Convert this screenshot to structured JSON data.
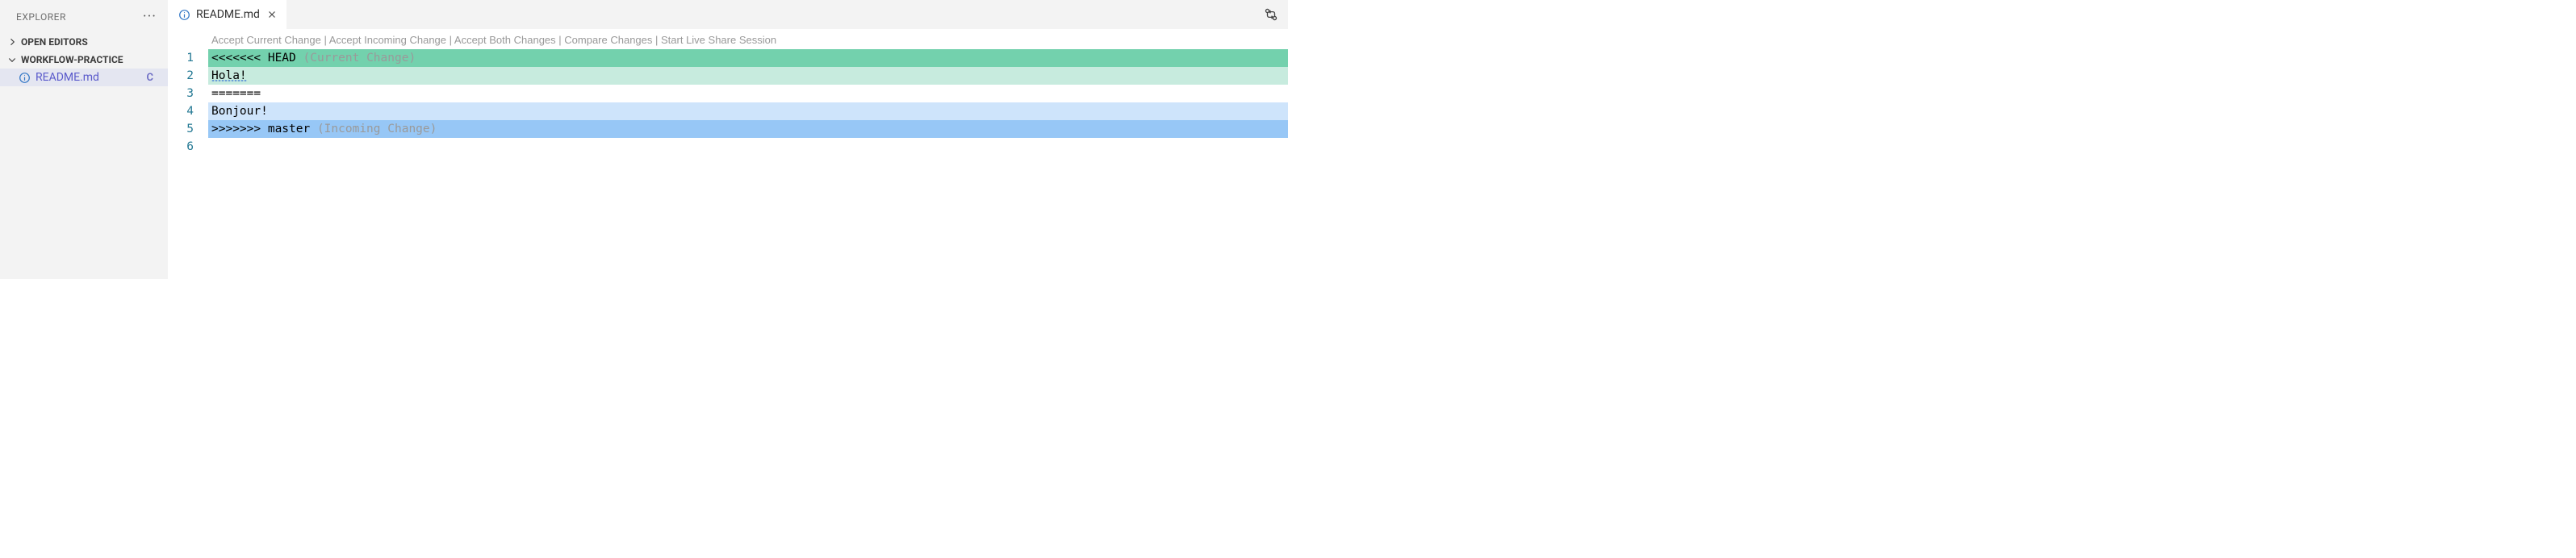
{
  "sidebar": {
    "title": "EXPLORER",
    "sections": [
      {
        "label": "OPEN EDITORS",
        "expanded": false
      },
      {
        "label": "WORKFLOW-PRACTICE",
        "expanded": true
      }
    ],
    "file": {
      "name": "README.md",
      "status": "C"
    }
  },
  "tab": {
    "name": "README.md"
  },
  "codelens": {
    "actions": [
      "Accept Current Change",
      "Accept Incoming Change",
      "Accept Both Changes",
      "Compare Changes",
      "Start Live Share Session"
    ],
    "sep": " | "
  },
  "code": {
    "lines": [
      {
        "num": "1",
        "class": "line-current-head",
        "text": "<<<<<<< HEAD ",
        "hint": "(Current Change)"
      },
      {
        "num": "2",
        "class": "line-current-body",
        "text": "Hola!",
        "squiggle": true
      },
      {
        "num": "3",
        "class": "line-sep",
        "text": "======="
      },
      {
        "num": "4",
        "class": "line-incoming-body",
        "text": "Bonjour!"
      },
      {
        "num": "5",
        "class": "line-incoming-head",
        "text": ">>>>>>> master ",
        "hint": "(Incoming Change)"
      },
      {
        "num": "6",
        "class": "",
        "text": ""
      }
    ]
  }
}
